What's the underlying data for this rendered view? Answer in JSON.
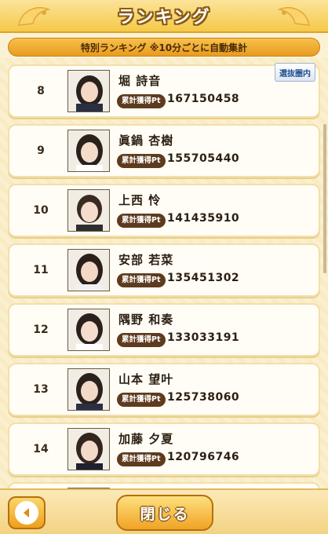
{
  "header": {
    "title": "ランキング",
    "subtitle": "特別ランキング ※10分ごとに自動集計"
  },
  "tag_label": "選抜圏内",
  "pt_label": "累計獲得Pt",
  "rows": [
    {
      "rank": "8",
      "name": "堀 詩音",
      "points": "167150458"
    },
    {
      "rank": "9",
      "name": "眞鍋 杏樹",
      "points": "155705440"
    },
    {
      "rank": "10",
      "name": "上西 怜",
      "points": "141435910"
    },
    {
      "rank": "11",
      "name": "安部 若菜",
      "points": "135451302"
    },
    {
      "rank": "12",
      "name": "隅野 和奏",
      "points": "133033191"
    },
    {
      "rank": "13",
      "name": "山本 望叶",
      "points": "125738060"
    },
    {
      "rank": "14",
      "name": "加藤 夕夏",
      "points": "120796746"
    }
  ],
  "footer": {
    "close_label": "閉じる"
  },
  "colors": {
    "accent": "#f0a324",
    "badge": "#5e3b1f",
    "tag_text": "#1f4f8f"
  }
}
